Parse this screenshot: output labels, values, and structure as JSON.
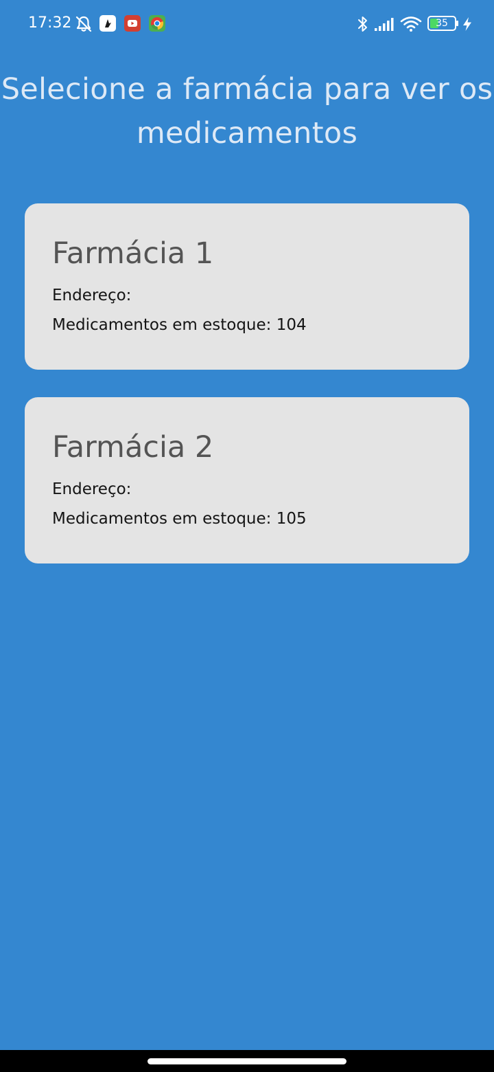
{
  "colors": {
    "background": "#3487d0",
    "title_text": "#dde9f6",
    "status_text": "#ffffff",
    "card_background": "#e4e4e4",
    "card_title": "#545454",
    "card_text": "#141414",
    "nav_bar": "#000000",
    "home_indicator": "#ffffff",
    "battery_fill": "#4cd964"
  },
  "status_bar": {
    "time": "17:32",
    "notification_icons": [
      "muted-bell-icon",
      "app-notification-icon",
      "youtube-icon",
      "chrome-icon"
    ],
    "system_icons": [
      "bluetooth-icon",
      "signal-icon",
      "wifi-icon",
      "battery-icon",
      "charging-icon"
    ],
    "battery_level": "35"
  },
  "header": {
    "title": "Selecione a farmácia para ver os medicamentos"
  },
  "pharmacies": [
    {
      "name": "Farmácia 1",
      "address_label": "Endereço:",
      "stock_line": "Medicamentos em estoque: 104"
    },
    {
      "name": "Farmácia 2",
      "address_label": "Endereço:",
      "stock_line": "Medicamentos em estoque: 105"
    }
  ]
}
